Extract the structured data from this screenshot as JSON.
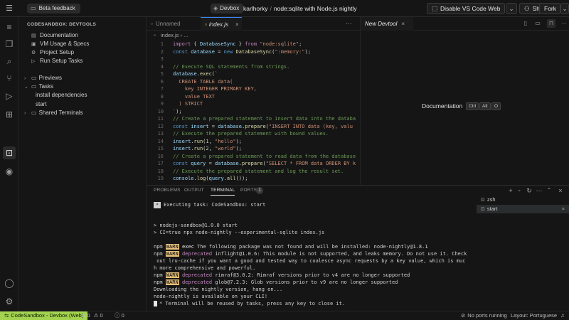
{
  "topbar": {
    "beta_feedback": "Beta feedback",
    "devbox": "Devbox",
    "owner": "karlhorky",
    "separator": "/",
    "project": "node:sqlite with Node.js nightly",
    "disable_vscode": "Disable VS Code Web",
    "share": "Share",
    "fork": "Fork"
  },
  "sidebar": {
    "title": "CODESANDBOX: DEVTOOLS",
    "items": [
      {
        "label": "Documentation",
        "icon": "book-icon"
      },
      {
        "label": "VM Usage & Specs",
        "icon": "chip-icon"
      },
      {
        "label": "Project Setup",
        "icon": "gear-icon"
      },
      {
        "label": "Run Setup Tasks",
        "icon": "play-icon"
      }
    ],
    "sections": {
      "previews": "Previews",
      "tasks": "Tasks",
      "task_items": [
        "install dependencies",
        "start"
      ],
      "shared_terminals": "Shared Terminals"
    }
  },
  "editor": {
    "tabs": [
      "Unnamed",
      "index.js"
    ],
    "breadcrumb_file": "index.js",
    "breadcrumb_sep": "›",
    "breadcrumb_more": "...",
    "line_numbers": [
      "1",
      "2",
      "3",
      "4",
      "5",
      "6",
      "7",
      "8",
      "9",
      "10",
      "11",
      "12",
      "13",
      "14",
      "15",
      "16",
      "17",
      "18",
      "19"
    ]
  },
  "devtool": {
    "tab": "New Devtool",
    "documentation": "Documentation",
    "keys": [
      "Ctrl",
      "Alt",
      "O"
    ]
  },
  "panel": {
    "tabs": [
      "PROBLEMS",
      "OUTPUT",
      "TERMINAL",
      "PORTS"
    ],
    "ports_count": "1",
    "task_line": "Executing task: CodeSandbox: start",
    "lines": [
      "> nodejs-sandbox@1.0.0 start",
      "> CI=true npx node-nightly --experimental-sqlite index.js"
    ],
    "npm_lines": [
      {
        "prefix": "npm",
        "badge": "WARN",
        "kind": "exec",
        "text": " The following package was not found and will be installed: node-nightly@1.8.1"
      },
      {
        "prefix": "npm",
        "badge": "WARN",
        "kind": "deprecated",
        "text": " inflight@1.0.6: This module is not supported, and leaks memory. Do not use it. Check"
      },
      {
        "prefix": "",
        "badge": "",
        "kind": "",
        "text": " out lru-cache if you want a good and tested way to coalesce async requests by a key value, which is muc"
      },
      {
        "prefix": "",
        "badge": "",
        "kind": "",
        "text": "h more comprehensive and powerful."
      },
      {
        "prefix": "npm",
        "badge": "WARN",
        "kind": "deprecated",
        "text": " rimraf@3.0.2: Rimraf versions prior to v4 are no longer supported"
      },
      {
        "prefix": "npm",
        "badge": "WARN",
        "kind": "deprecated",
        "text": " glob@7.2.3: Glob versions prior to v9 are no longer supported"
      }
    ],
    "downloading": "Downloading the nightly version, hang on...",
    "available": "node-nightly is available on your CLI!",
    "reuse": "Terminal will be reused by tasks, press any key to close it.",
    "terminals": [
      "zsh",
      "start"
    ]
  },
  "status": {
    "remote": "CodeSandbox - Devbox (Web)",
    "errors": "0",
    "warnings": "0",
    "info": "0",
    "ports": "No ports running",
    "layout": "Layout: Portuguese"
  },
  "colors": {
    "accent": "#3a88ff",
    "remote_bg": "#a3d34f",
    "warn_badge": "#e5c07b"
  }
}
